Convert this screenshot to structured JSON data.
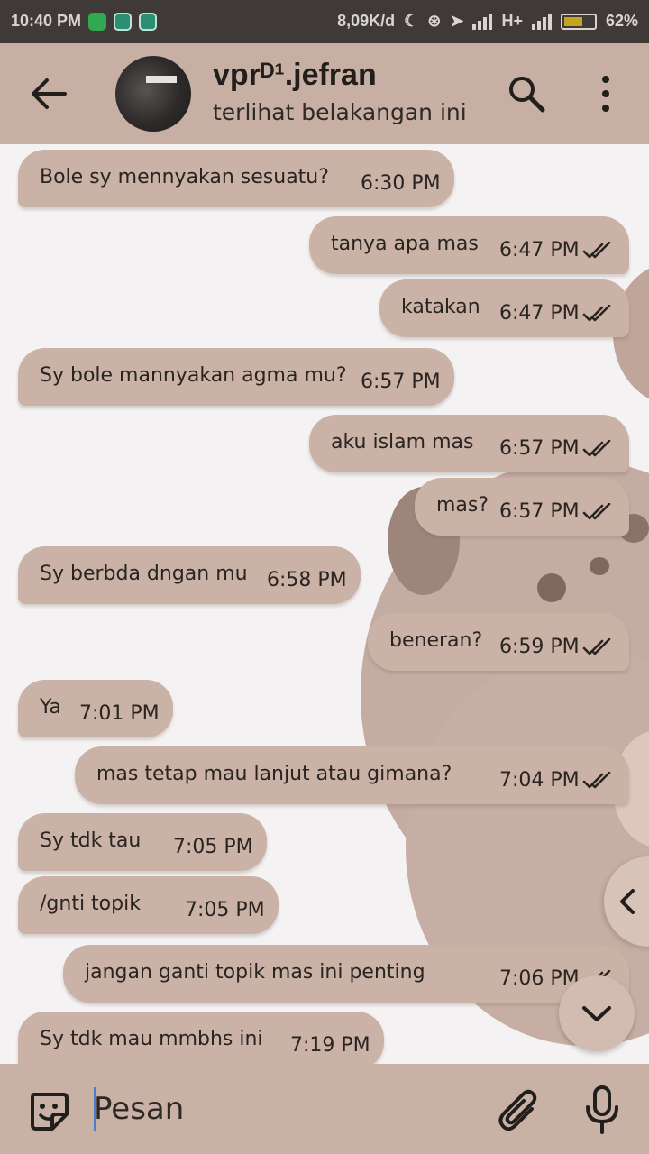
{
  "status_bar": {
    "time": "10:40 PM",
    "speed": "8,09K/d",
    "network": "H+",
    "battery": "62%",
    "battery_level": 0.62
  },
  "header": {
    "contact_name": "vprᴰ¹.jefran",
    "last_seen": "terlihat belakangan ini",
    "icons": [
      "back-arrow-icon",
      "search-icon",
      "more-options-icon"
    ]
  },
  "messages": [
    {
      "dir": "in",
      "text": "Bole sy mennyakan sesuatu?",
      "time": "6:30 PM"
    },
    {
      "dir": "out",
      "text": "tanya apa mas",
      "time": "6:47 PM"
    },
    {
      "dir": "out",
      "text": "katakan",
      "time": "6:47 PM"
    },
    {
      "dir": "in",
      "text": "Sy bole mannyakan agma mu?",
      "time": "6:57 PM"
    },
    {
      "dir": "out",
      "text": "aku islam mas",
      "time": "6:57 PM"
    },
    {
      "dir": "out",
      "text": "mas?",
      "time": "6:57 PM"
    },
    {
      "dir": "in",
      "text": "Sy berbda dngan mu",
      "time": "6:58 PM"
    },
    {
      "dir": "out",
      "text": "beneran?",
      "time": "6:59 PM"
    },
    {
      "dir": "in",
      "text": "Ya",
      "time": "7:01 PM"
    },
    {
      "dir": "out",
      "text": "mas tetap mau lanjut atau gimana?",
      "time": "7:04 PM"
    },
    {
      "dir": "in",
      "text": "Sy tdk tau",
      "time": "7:05 PM"
    },
    {
      "dir": "in",
      "text": "/gnti topik",
      "time": "7:05 PM"
    },
    {
      "dir": "out",
      "text": "jangan ganti topik mas ini penting",
      "time": "7:06 PM"
    },
    {
      "dir": "in",
      "text": "Sy tdk mau mmbhs ini",
      "time": "7:19 PM"
    }
  ],
  "input": {
    "placeholder": "Pesan",
    "value": ""
  },
  "colors": {
    "header_bg": "#c7afa3",
    "bubble_bg": "#cab2a7",
    "chat_bg": "#f4f2f2",
    "statusbar_bg": "#3f3a38"
  }
}
